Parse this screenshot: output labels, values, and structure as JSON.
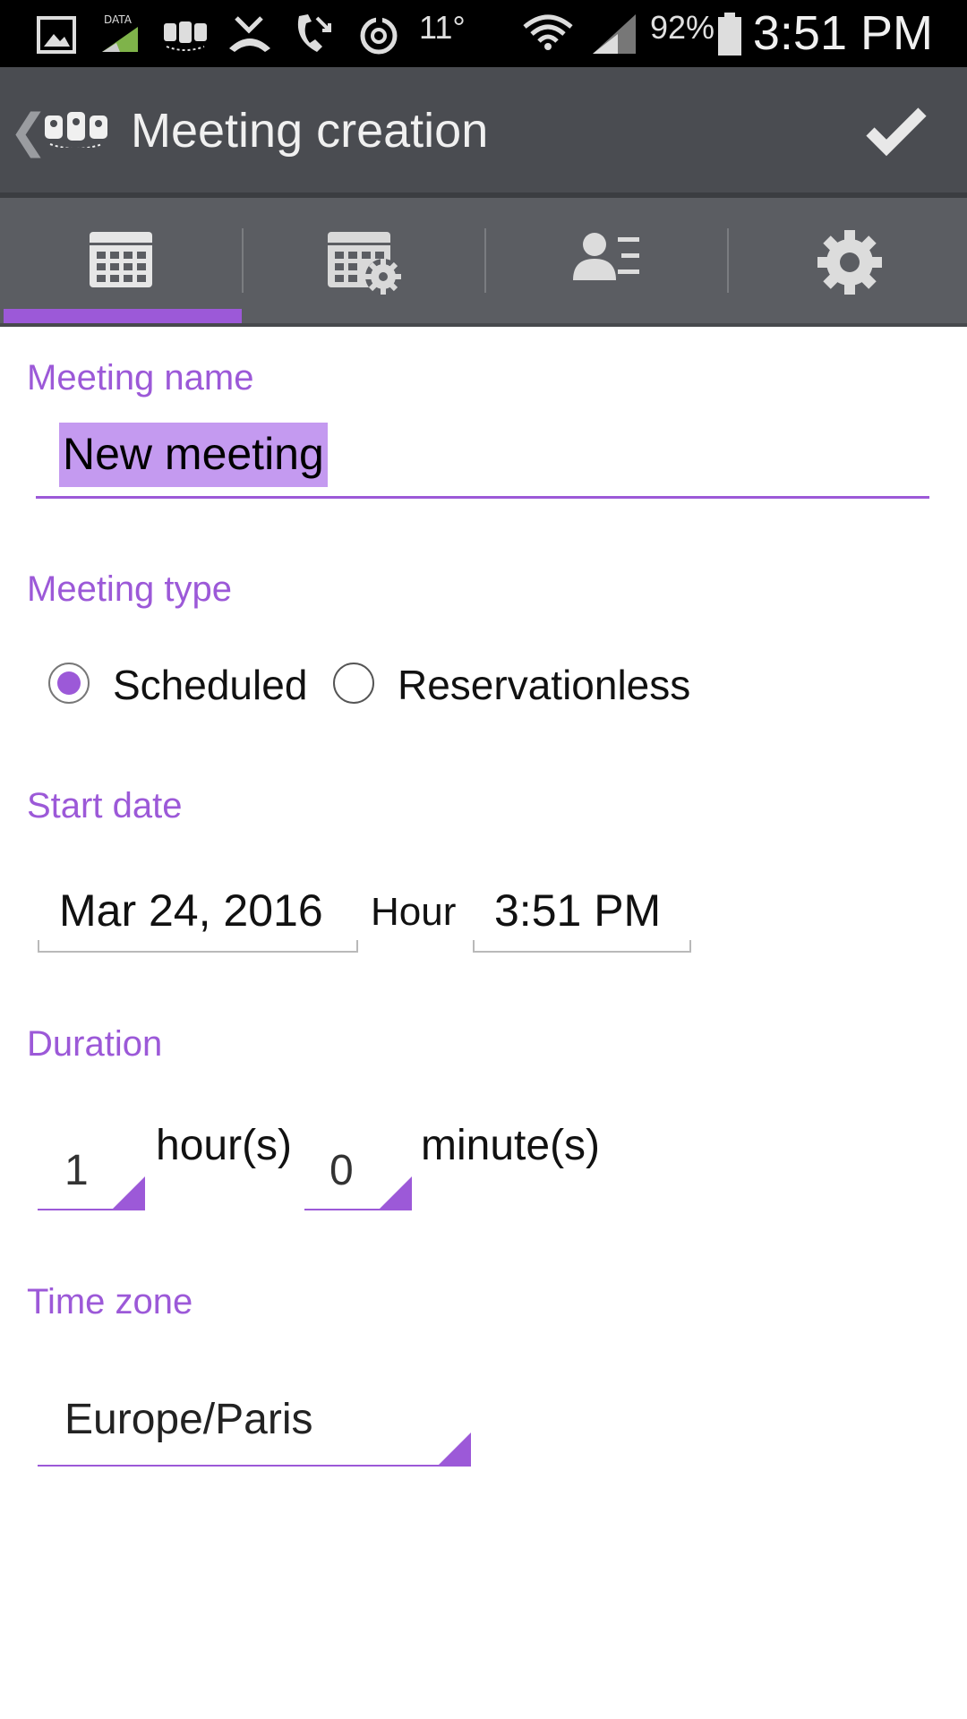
{
  "status_bar": {
    "data_label": "DATA",
    "temperature": "11°",
    "battery": "92%",
    "time": "3:51 PM"
  },
  "action_bar": {
    "back_icon": "chevron-left-icon",
    "title": "Meeting creation",
    "confirm_icon": "check-icon"
  },
  "tabs": [
    {
      "icon": "calendar-icon",
      "selected": true
    },
    {
      "icon": "calendar-settings-icon",
      "selected": false
    },
    {
      "icon": "participants-icon",
      "selected": false
    },
    {
      "icon": "gear-icon",
      "selected": false
    }
  ],
  "form": {
    "meeting_name": {
      "label": "Meeting name",
      "value": "New meeting"
    },
    "meeting_type": {
      "label": "Meeting type",
      "options": [
        {
          "label": "Scheduled",
          "checked": true
        },
        {
          "label": "Reservationless",
          "checked": false
        }
      ]
    },
    "start_date": {
      "label": "Start date",
      "date": "Mar 24, 2016",
      "hour_label": "Hour",
      "time": "3:51 PM"
    },
    "duration": {
      "label": "Duration",
      "hours": "1",
      "hours_unit": "hour(s)",
      "minutes": "0",
      "minutes_unit": "minute(s)"
    },
    "time_zone": {
      "label": "Time zone",
      "value": "Europe/Paris"
    }
  },
  "colors": {
    "accent": "#9c59d8",
    "action_bar": "#4a4c51",
    "tab_bar": "#5b5d62",
    "status_bar": "#000000"
  }
}
